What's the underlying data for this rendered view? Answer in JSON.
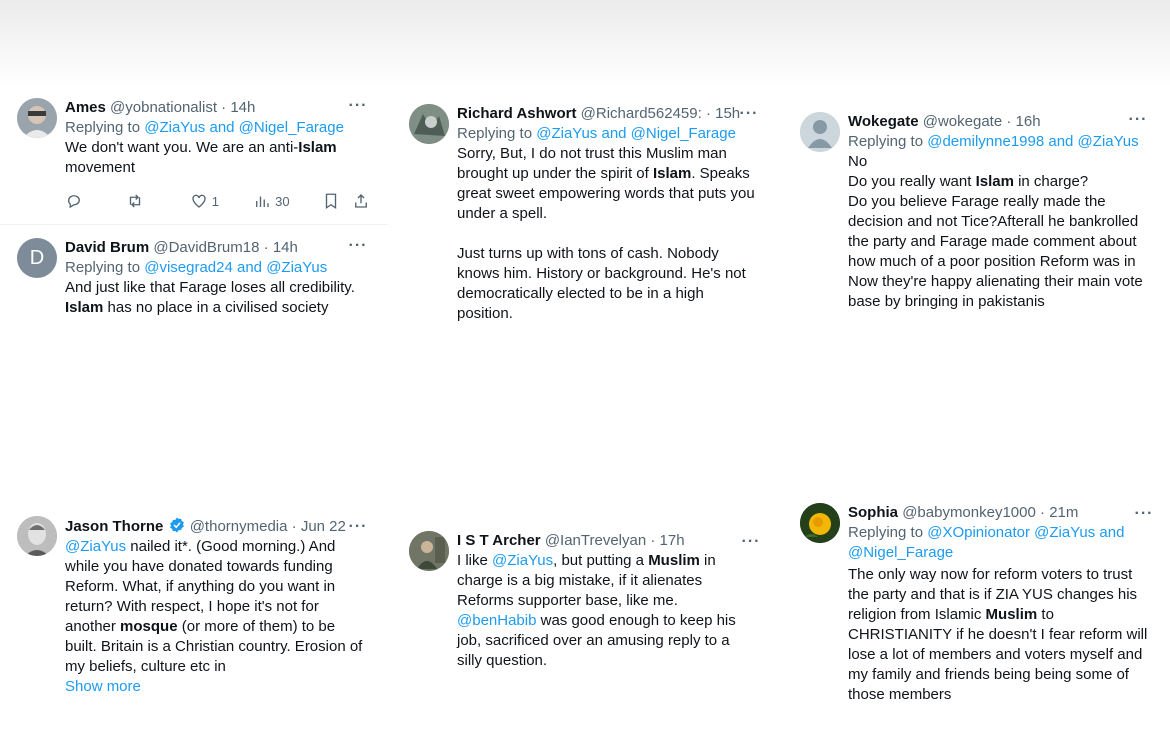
{
  "tweets": [
    {
      "name": "Ames",
      "handle": "@yobnationalist",
      "sep": "·",
      "time": "14h",
      "replying_prefix": "Replying to ",
      "replying_mentions": "@ZiaYus and @Nigel_Farage",
      "text_a": "We don't want you. We are an anti-",
      "text_b": "Islam",
      "text_c": "movement",
      "actions": {
        "replies": "",
        "retweets": "",
        "likes": "1",
        "views": "30"
      }
    },
    {
      "name": "David Brum",
      "handle": "@DavidBrum18",
      "sep": "·",
      "time": "14h",
      "avatar_letter": "D",
      "replying_prefix": "Replying to ",
      "replying_mentions": "@visegrad24 and @ZiaYus",
      "text_a": "And just like that Farage loses all credibility.",
      "text_b": "Islam",
      "text_c": " has no place in a civilised society"
    },
    {
      "name": "Richard Ashwort",
      "handle": "@Richard562459:",
      "sep": "·",
      "time": "15h",
      "replying_prefix": "Replying to ",
      "replying_mentions": "@ZiaYus and @Nigel_Farage",
      "text_a": "Sorry, But, I do not trust this Muslim man brought up under the spirit of ",
      "text_b": "Islam",
      "text_c": ". Speaks great sweet empowering words that puts you under a spell.",
      "text_d": "Just turns up with tons of cash. Nobody knows him. History or background.  He's not democratically elected to be in a high position."
    },
    {
      "name": "Wokegate",
      "handle": "@wokegate",
      "sep": "·",
      "time": "16h",
      "replying_prefix": "Replying to ",
      "replying_mentions": "@demilynne1998 and @ZiaYus",
      "text_a": "No",
      "text_b": "Do you really want ",
      "text_c": "Islam",
      "text_d": " in charge?",
      "text_e": "Do you believe Farage really made the decision and not Tice?Afterall he bankrolled the party and Farage made comment about how much of a poor position Reform was in",
      "text_f": "Now they're happy alienating their main vote base by bringing in pakistanis"
    },
    {
      "name": "Jason Thorne",
      "handle": "@thornymedia",
      "sep": "·",
      "time": "Jun 22",
      "verified_color": "#1d9bf0",
      "mention": "@ZiaYus",
      "text_a": " nailed it*. (Good morning.) And while you have donated towards funding Reform. What, if anything do you want in return? With respect, I hope it's not for another ",
      "text_b": "mosque",
      "text_c": " (or more of them) to be built. Britain is a Christian country. Erosion of my beliefs, culture etc in",
      "show_more": "Show more"
    },
    {
      "name": "I S T Archer",
      "handle": "@IanTrevelyan",
      "sep": "·",
      "time": "17h",
      "text_a": "I like ",
      "mention_a": "@ZiaYus",
      "text_b": ", but putting a ",
      "text_c": "Muslim",
      "text_d": " in charge is a big mistake, if it alienates Reforms supporter base, like me.",
      "mention_b": "@benHabib",
      "text_e": " was good enough to keep his job, sacrificed over an amusing reply to a silly question."
    },
    {
      "name": "Sophia",
      "handle": "@babymonkey1000",
      "sep": "·",
      "time": "21m",
      "replying_prefix": "Replying to ",
      "replying_mentions": "@XOpinionator @ZiaYus and @Nigel_Farage",
      "text_a": "The only way now for reform voters to trust the party and that is if ZIA YUS changes his religion from Islamic ",
      "text_b": "Muslim",
      "text_c": " to CHRISTIANITY if he doesn't I fear reform will lose a lot of members and voters myself and my family and friends being being some of those members"
    }
  ],
  "icons": {
    "more": "more-options-icon",
    "reply": "reply-icon",
    "retweet": "retweet-icon",
    "like": "like-icon",
    "views": "views-icon",
    "bookmark": "bookmark-icon",
    "share": "share-icon",
    "verified": "verified-badge-icon"
  },
  "colors": {
    "accent": "#1d9bf0",
    "muted": "#536471",
    "text": "#0f1419"
  }
}
